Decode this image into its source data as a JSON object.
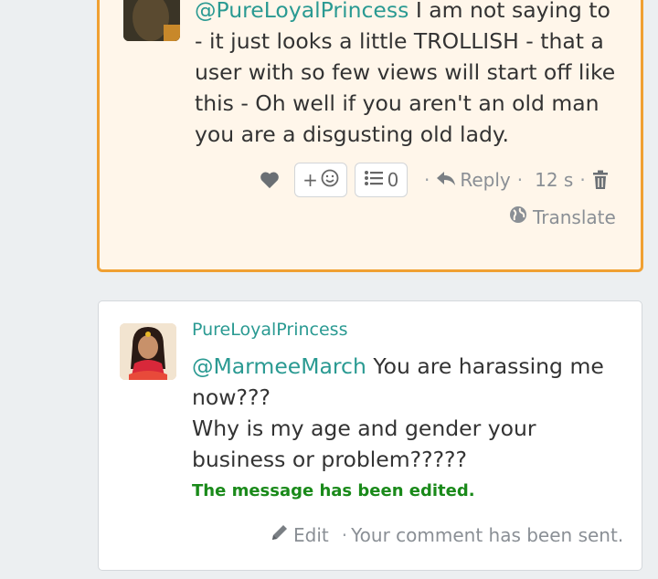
{
  "comment1": {
    "mention": "@PureLoyalPrincess",
    "text": " I am not saying to - it just looks a little TROLLISH - that a user with so few views will start off like this - Oh well if you aren't an old man you are a disgusting old lady.",
    "react_label": "+",
    "list_count": "0",
    "reply_label": "Reply",
    "time": "12 s",
    "translate_label": "Translate"
  },
  "comment2": {
    "author": "PureLoyalPrincess",
    "mention": "@MarmeeMarch",
    "line1": " You are harassing me now???",
    "line2": "Why is my age and gender your business or problem?????",
    "edited_note": "The message has been edited.",
    "edit_label": "Edit",
    "status": "Your comment has been sent."
  },
  "colors": {
    "accent": "#2a9a92",
    "highlight_border": "#f0a032",
    "highlight_bg": "#fff6ea",
    "edited": "#1a8a1a"
  }
}
